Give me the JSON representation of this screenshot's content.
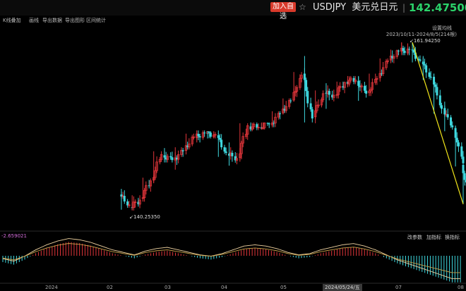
{
  "header": {
    "add_label": "加入自选",
    "symbol": "USDJPY",
    "name": "美元兑日元",
    "separator": "|",
    "price": "142.47500",
    "price_color": "#2bd36a",
    "star_icon": "star-icon"
  },
  "toolbar": {
    "items": [
      "K线叠加",
      "画线",
      "导出数据",
      "导出图形",
      "区间统计"
    ],
    "settings_label": "设置均线",
    "range_label": "2023/10/11-2024/8/5(214根)"
  },
  "annotations": {
    "high_label": "161.94250",
    "low_label": "140.25350"
  },
  "macd": {
    "value_label": "-2.659021",
    "buttons": [
      "改参数",
      "加指标",
      "换指标"
    ]
  },
  "xaxis": {
    "labels": [
      "2024",
      "02",
      "03",
      "04",
      "05",
      "07",
      "08"
    ],
    "cursor_date": "2024/05/24/五"
  },
  "colors": {
    "up": "#e0353a",
    "down": "#3fd9e0",
    "trend_line": "#f2e61a",
    "dif": "#f0d3a0",
    "dea": "#c9a24a"
  },
  "chart_data": {
    "type": "candlestick",
    "series_name": "USDJPY",
    "x_range": [
      "2023-10-11",
      "2024-08-05"
    ],
    "ylim": [
      138.5,
      163.5
    ],
    "candles_weekly_approx": [
      {
        "date": "2023-12-27",
        "open": 142.9,
        "high": 143.6,
        "low": 141.0,
        "close": 141.6
      },
      {
        "date": "2024-01-03",
        "open": 141.3,
        "high": 142.8,
        "low": 140.9,
        "close": 142.2
      },
      {
        "date": "2024-01-10",
        "open": 142.4,
        "high": 145.0,
        "low": 142.0,
        "close": 144.6
      },
      {
        "date": "2024-01-17",
        "open": 144.7,
        "high": 148.3,
        "low": 144.3,
        "close": 147.9
      },
      {
        "date": "2024-01-24",
        "open": 147.8,
        "high": 148.7,
        "low": 146.9,
        "close": 147.2
      },
      {
        "date": "2024-01-31",
        "open": 147.2,
        "high": 148.8,
        "low": 146.0,
        "close": 148.3
      },
      {
        "date": "2024-02-07",
        "open": 148.4,
        "high": 150.5,
        "low": 147.9,
        "close": 150.1
      },
      {
        "date": "2024-02-14",
        "open": 150.0,
        "high": 150.9,
        "low": 149.4,
        "close": 150.6
      },
      {
        "date": "2024-02-21",
        "open": 150.5,
        "high": 150.8,
        "low": 149.9,
        "close": 150.4
      },
      {
        "date": "2024-02-28",
        "open": 150.3,
        "high": 150.9,
        "low": 147.6,
        "close": 148.1
      },
      {
        "date": "2024-03-06",
        "open": 148.0,
        "high": 149.4,
        "low": 146.5,
        "close": 147.4
      },
      {
        "date": "2024-03-13",
        "open": 147.5,
        "high": 151.8,
        "low": 147.0,
        "close": 151.5
      },
      {
        "date": "2024-03-20",
        "open": 151.4,
        "high": 151.9,
        "low": 150.8,
        "close": 151.3
      },
      {
        "date": "2024-03-27",
        "open": 151.3,
        "high": 151.9,
        "low": 151.0,
        "close": 151.7
      },
      {
        "date": "2024-04-03",
        "open": 151.6,
        "high": 153.3,
        "low": 151.3,
        "close": 153.0
      },
      {
        "date": "2024-04-10",
        "open": 153.1,
        "high": 154.9,
        "low": 152.9,
        "close": 154.6
      },
      {
        "date": "2024-04-17",
        "open": 154.7,
        "high": 158.2,
        "low": 154.5,
        "close": 157.8
      },
      {
        "date": "2024-04-24",
        "open": 158.0,
        "high": 160.2,
        "low": 151.9,
        "close": 152.4
      },
      {
        "date": "2024-05-01",
        "open": 152.6,
        "high": 155.9,
        "low": 151.8,
        "close": 155.5
      },
      {
        "date": "2024-05-08",
        "open": 155.6,
        "high": 156.8,
        "low": 153.6,
        "close": 155.3
      },
      {
        "date": "2024-05-15",
        "open": 155.3,
        "high": 157.0,
        "low": 154.9,
        "close": 156.9
      },
      {
        "date": "2024-05-22",
        "open": 157.0,
        "high": 157.7,
        "low": 156.3,
        "close": 157.2
      },
      {
        "date": "2024-05-29",
        "open": 157.1,
        "high": 157.7,
        "low": 154.6,
        "close": 155.5
      },
      {
        "date": "2024-06-05",
        "open": 155.6,
        "high": 158.0,
        "low": 155.2,
        "close": 157.4
      },
      {
        "date": "2024-06-12",
        "open": 157.5,
        "high": 159.9,
        "low": 157.0,
        "close": 159.6
      },
      {
        "date": "2024-06-19",
        "open": 159.7,
        "high": 161.0,
        "low": 159.3,
        "close": 160.8
      },
      {
        "date": "2024-06-26",
        "open": 160.8,
        "high": 161.9,
        "low": 160.3,
        "close": 161.0
      },
      {
        "date": "2024-07-03",
        "open": 161.0,
        "high": 161.9,
        "low": 159.4,
        "close": 159.6
      },
      {
        "date": "2024-07-10",
        "open": 159.5,
        "high": 160.2,
        "low": 157.2,
        "close": 157.5
      },
      {
        "date": "2024-07-17",
        "open": 157.6,
        "high": 158.0,
        "low": 153.0,
        "close": 153.6
      },
      {
        "date": "2024-07-24",
        "open": 153.7,
        "high": 154.5,
        "low": 150.8,
        "close": 151.3
      },
      {
        "date": "2024-07-31",
        "open": 151.2,
        "high": 151.5,
        "low": 146.4,
        "close": 146.8
      },
      {
        "date": "2024-08-05",
        "open": 146.6,
        "high": 147.2,
        "low": 141.7,
        "close": 142.5
      }
    ],
    "trend_line": {
      "from": {
        "date": "2024-07-03",
        "price": 161.9
      },
      "to": {
        "date": "2024-08-05",
        "price": 141.7
      }
    },
    "macd_hist_approx": [
      -0.5,
      -0.7,
      -0.3,
      0.2,
      0.6,
      0.9,
      1.1,
      1.0,
      0.8,
      0.5,
      0.2,
      0.0,
      -0.2,
      0.1,
      0.3,
      0.4,
      0.2,
      0.0,
      -0.2,
      -0.3,
      -0.1,
      0.2,
      0.5,
      0.6,
      0.5,
      0.3,
      0.0,
      -0.2,
      -0.1,
      0.2,
      0.4,
      0.6,
      0.7,
      0.5,
      0.2,
      -0.2,
      -0.6,
      -0.9,
      -1.2,
      -1.5,
      -1.8,
      -2.1
    ]
  }
}
